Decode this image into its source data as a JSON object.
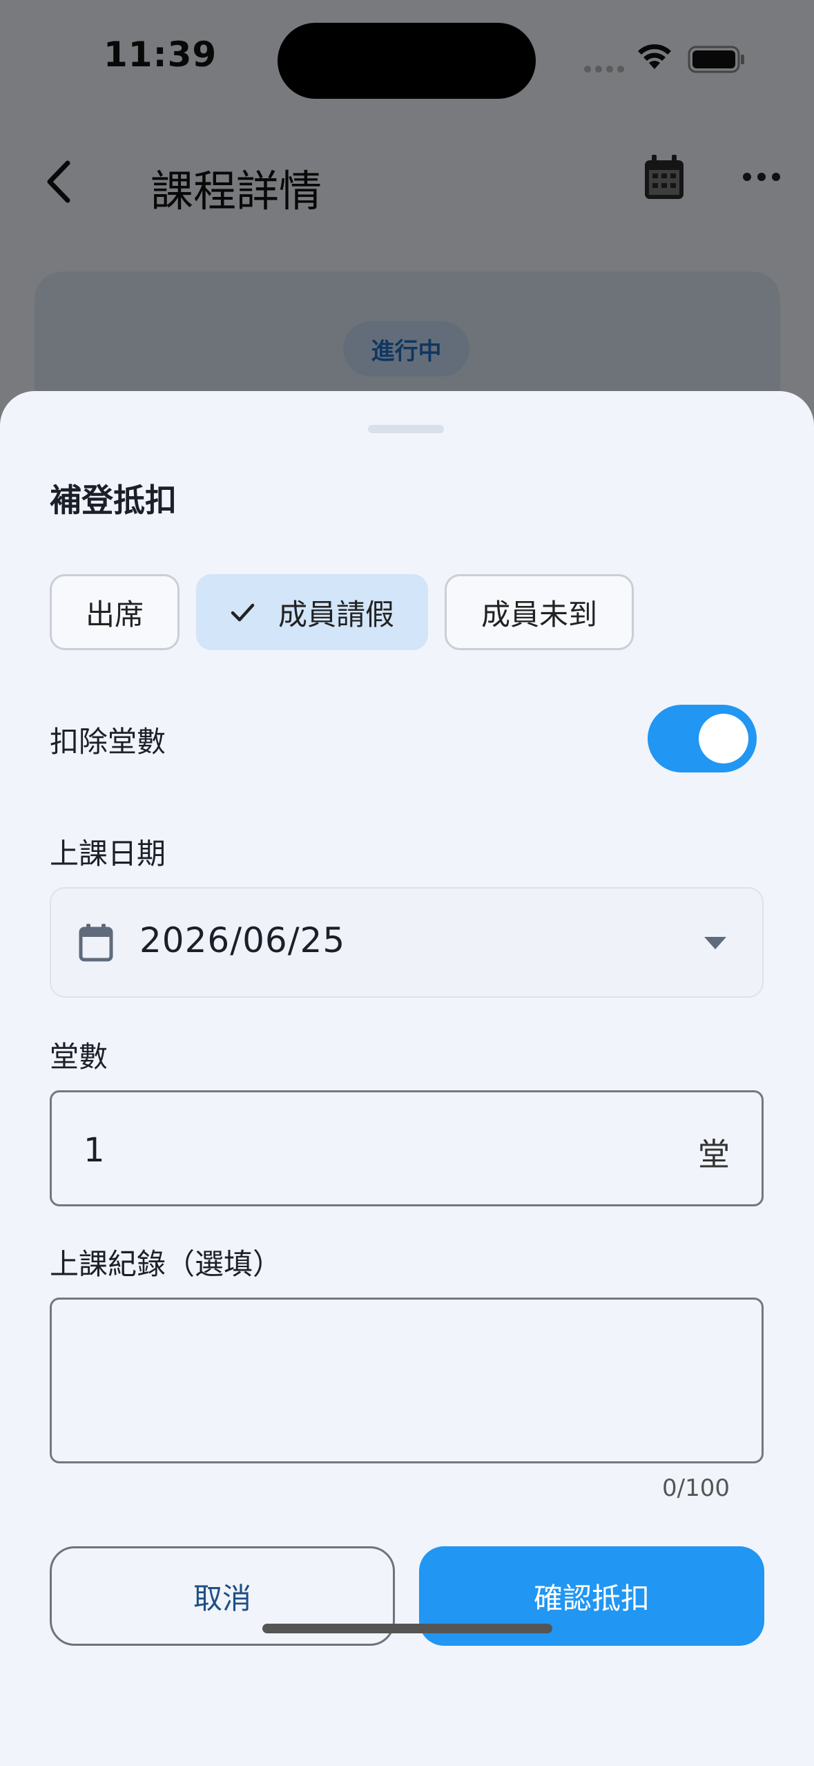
{
  "status_bar": {
    "time": "11:39"
  },
  "header": {
    "title": "課程詳情"
  },
  "course_card": {
    "status": "進行中"
  },
  "sheet": {
    "title": "補登抵扣",
    "attendance_options": [
      {
        "label": "出席",
        "selected": false
      },
      {
        "label": "成員請假",
        "selected": true
      },
      {
        "label": "成員未到",
        "selected": false
      }
    ],
    "deduct_label": "扣除堂數",
    "deduct_enabled": true,
    "date_label": "上課日期",
    "date_value": "2026/06/25",
    "count_label": "堂數",
    "count_value": "1",
    "count_suffix": "堂",
    "notes_label": "上課紀錄（選填）",
    "notes_value": "",
    "notes_counter": "0/100",
    "cancel_label": "取消",
    "confirm_label": "確認抵扣"
  },
  "colors": {
    "accent": "#2196f3",
    "chip_selected": "#d3e5f8",
    "sheet_background": "#f1f4fa",
    "status_pill_text": "#1e6fc0"
  }
}
